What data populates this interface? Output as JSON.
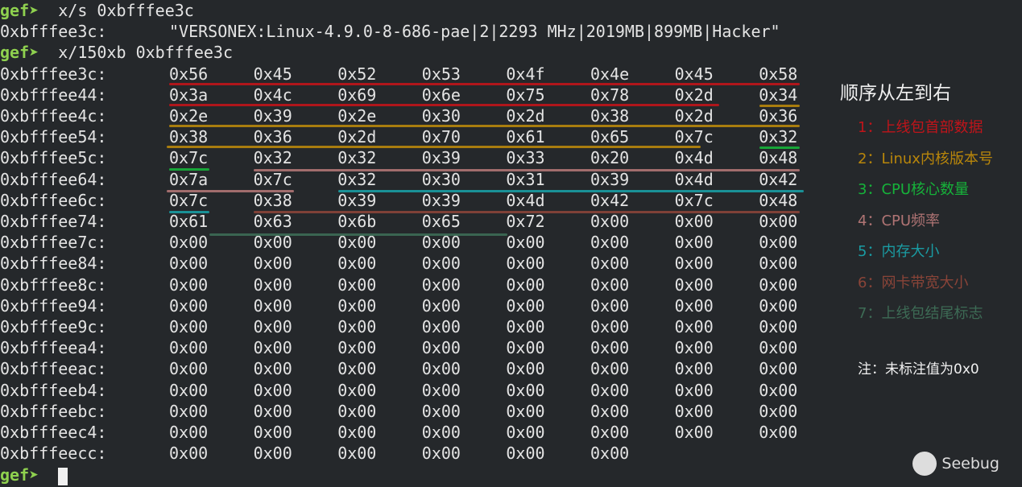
{
  "terminal": {
    "prompt": "gef➤",
    "cmd1": "  x/s 0xbfffee3c",
    "string_addr": "0xbfffee3c:",
    "string_value": "\"VERSONEX:Linux-4.9.0-8-686-pae|2|2293 MHz|2019MB|899MB|Hacker\"",
    "cmd2": "  x/150xb 0xbfffee3c",
    "rows": [
      {
        "addr": "0xbfffee3c:",
        "bytes": [
          "0x56",
          "0x45",
          "0x52",
          "0x53",
          "0x4f",
          "0x4e",
          "0x45",
          "0x58"
        ]
      },
      {
        "addr": "0xbfffee44:",
        "bytes": [
          "0x3a",
          "0x4c",
          "0x69",
          "0x6e",
          "0x75",
          "0x78",
          "0x2d",
          "0x34"
        ]
      },
      {
        "addr": "0xbfffee4c:",
        "bytes": [
          "0x2e",
          "0x39",
          "0x2e",
          "0x30",
          "0x2d",
          "0x38",
          "0x2d",
          "0x36"
        ]
      },
      {
        "addr": "0xbfffee54:",
        "bytes": [
          "0x38",
          "0x36",
          "0x2d",
          "0x70",
          "0x61",
          "0x65",
          "0x7c",
          "0x32"
        ]
      },
      {
        "addr": "0xbfffee5c:",
        "bytes": [
          "0x7c",
          "0x32",
          "0x32",
          "0x39",
          "0x33",
          "0x20",
          "0x4d",
          "0x48"
        ]
      },
      {
        "addr": "0xbfffee64:",
        "bytes": [
          "0x7a",
          "0x7c",
          "0x32",
          "0x30",
          "0x31",
          "0x39",
          "0x4d",
          "0x42"
        ]
      },
      {
        "addr": "0xbfffee6c:",
        "bytes": [
          "0x7c",
          "0x38",
          "0x39",
          "0x39",
          "0x4d",
          "0x42",
          "0x7c",
          "0x48"
        ]
      },
      {
        "addr": "0xbfffee74:",
        "bytes": [
          "0x61",
          "0x63",
          "0x6b",
          "0x65",
          "0x72",
          "0x00",
          "0x00",
          "0x00"
        ]
      },
      {
        "addr": "0xbfffee7c:",
        "bytes": [
          "0x00",
          "0x00",
          "0x00",
          "0x00",
          "0x00",
          "0x00",
          "0x00",
          "0x00"
        ]
      },
      {
        "addr": "0xbfffee84:",
        "bytes": [
          "0x00",
          "0x00",
          "0x00",
          "0x00",
          "0x00",
          "0x00",
          "0x00",
          "0x00"
        ]
      },
      {
        "addr": "0xbfffee8c:",
        "bytes": [
          "0x00",
          "0x00",
          "0x00",
          "0x00",
          "0x00",
          "0x00",
          "0x00",
          "0x00"
        ]
      },
      {
        "addr": "0xbfffee94:",
        "bytes": [
          "0x00",
          "0x00",
          "0x00",
          "0x00",
          "0x00",
          "0x00",
          "0x00",
          "0x00"
        ]
      },
      {
        "addr": "0xbfffee9c:",
        "bytes": [
          "0x00",
          "0x00",
          "0x00",
          "0x00",
          "0x00",
          "0x00",
          "0x00",
          "0x00"
        ]
      },
      {
        "addr": "0xbfffeea4:",
        "bytes": [
          "0x00",
          "0x00",
          "0x00",
          "0x00",
          "0x00",
          "0x00",
          "0x00",
          "0x00"
        ]
      },
      {
        "addr": "0xbfffeeac:",
        "bytes": [
          "0x00",
          "0x00",
          "0x00",
          "0x00",
          "0x00",
          "0x00",
          "0x00",
          "0x00"
        ]
      },
      {
        "addr": "0xbfffeeb4:",
        "bytes": [
          "0x00",
          "0x00",
          "0x00",
          "0x00",
          "0x00",
          "0x00",
          "0x00",
          "0x00"
        ]
      },
      {
        "addr": "0xbfffeebc:",
        "bytes": [
          "0x00",
          "0x00",
          "0x00",
          "0x00",
          "0x00",
          "0x00",
          "0x00",
          "0x00"
        ]
      },
      {
        "addr": "0xbfffeec4:",
        "bytes": [
          "0x00",
          "0x00",
          "0x00",
          "0x00",
          "0x00",
          "0x00",
          "0x00",
          "0x00"
        ]
      },
      {
        "addr": "0xbfffeecc:",
        "bytes": [
          "0x00",
          "0x00",
          "0x00",
          "0x00",
          "0x00",
          "0x00"
        ]
      }
    ]
  },
  "legend": {
    "title": "顺序从左到右",
    "items": [
      {
        "label": "1：上线包首部数据",
        "color": "#c0141a"
      },
      {
        "label": "2：Linux内核版本号",
        "color": "#b8860b"
      },
      {
        "label": "3：CPU核心数量",
        "color": "#16b33a"
      },
      {
        "label": "4：CPU频率",
        "color": "#b07474"
      },
      {
        "label": "5：内存大小",
        "color": "#1a9ca3"
      },
      {
        "label": "6：网卡带宽大小",
        "color": "#8a4438"
      },
      {
        "label": "7：上线包结尾标志",
        "color": "#3d6b55"
      }
    ],
    "note": "注：未标注值为0x0"
  },
  "watermark": "Seebug"
}
